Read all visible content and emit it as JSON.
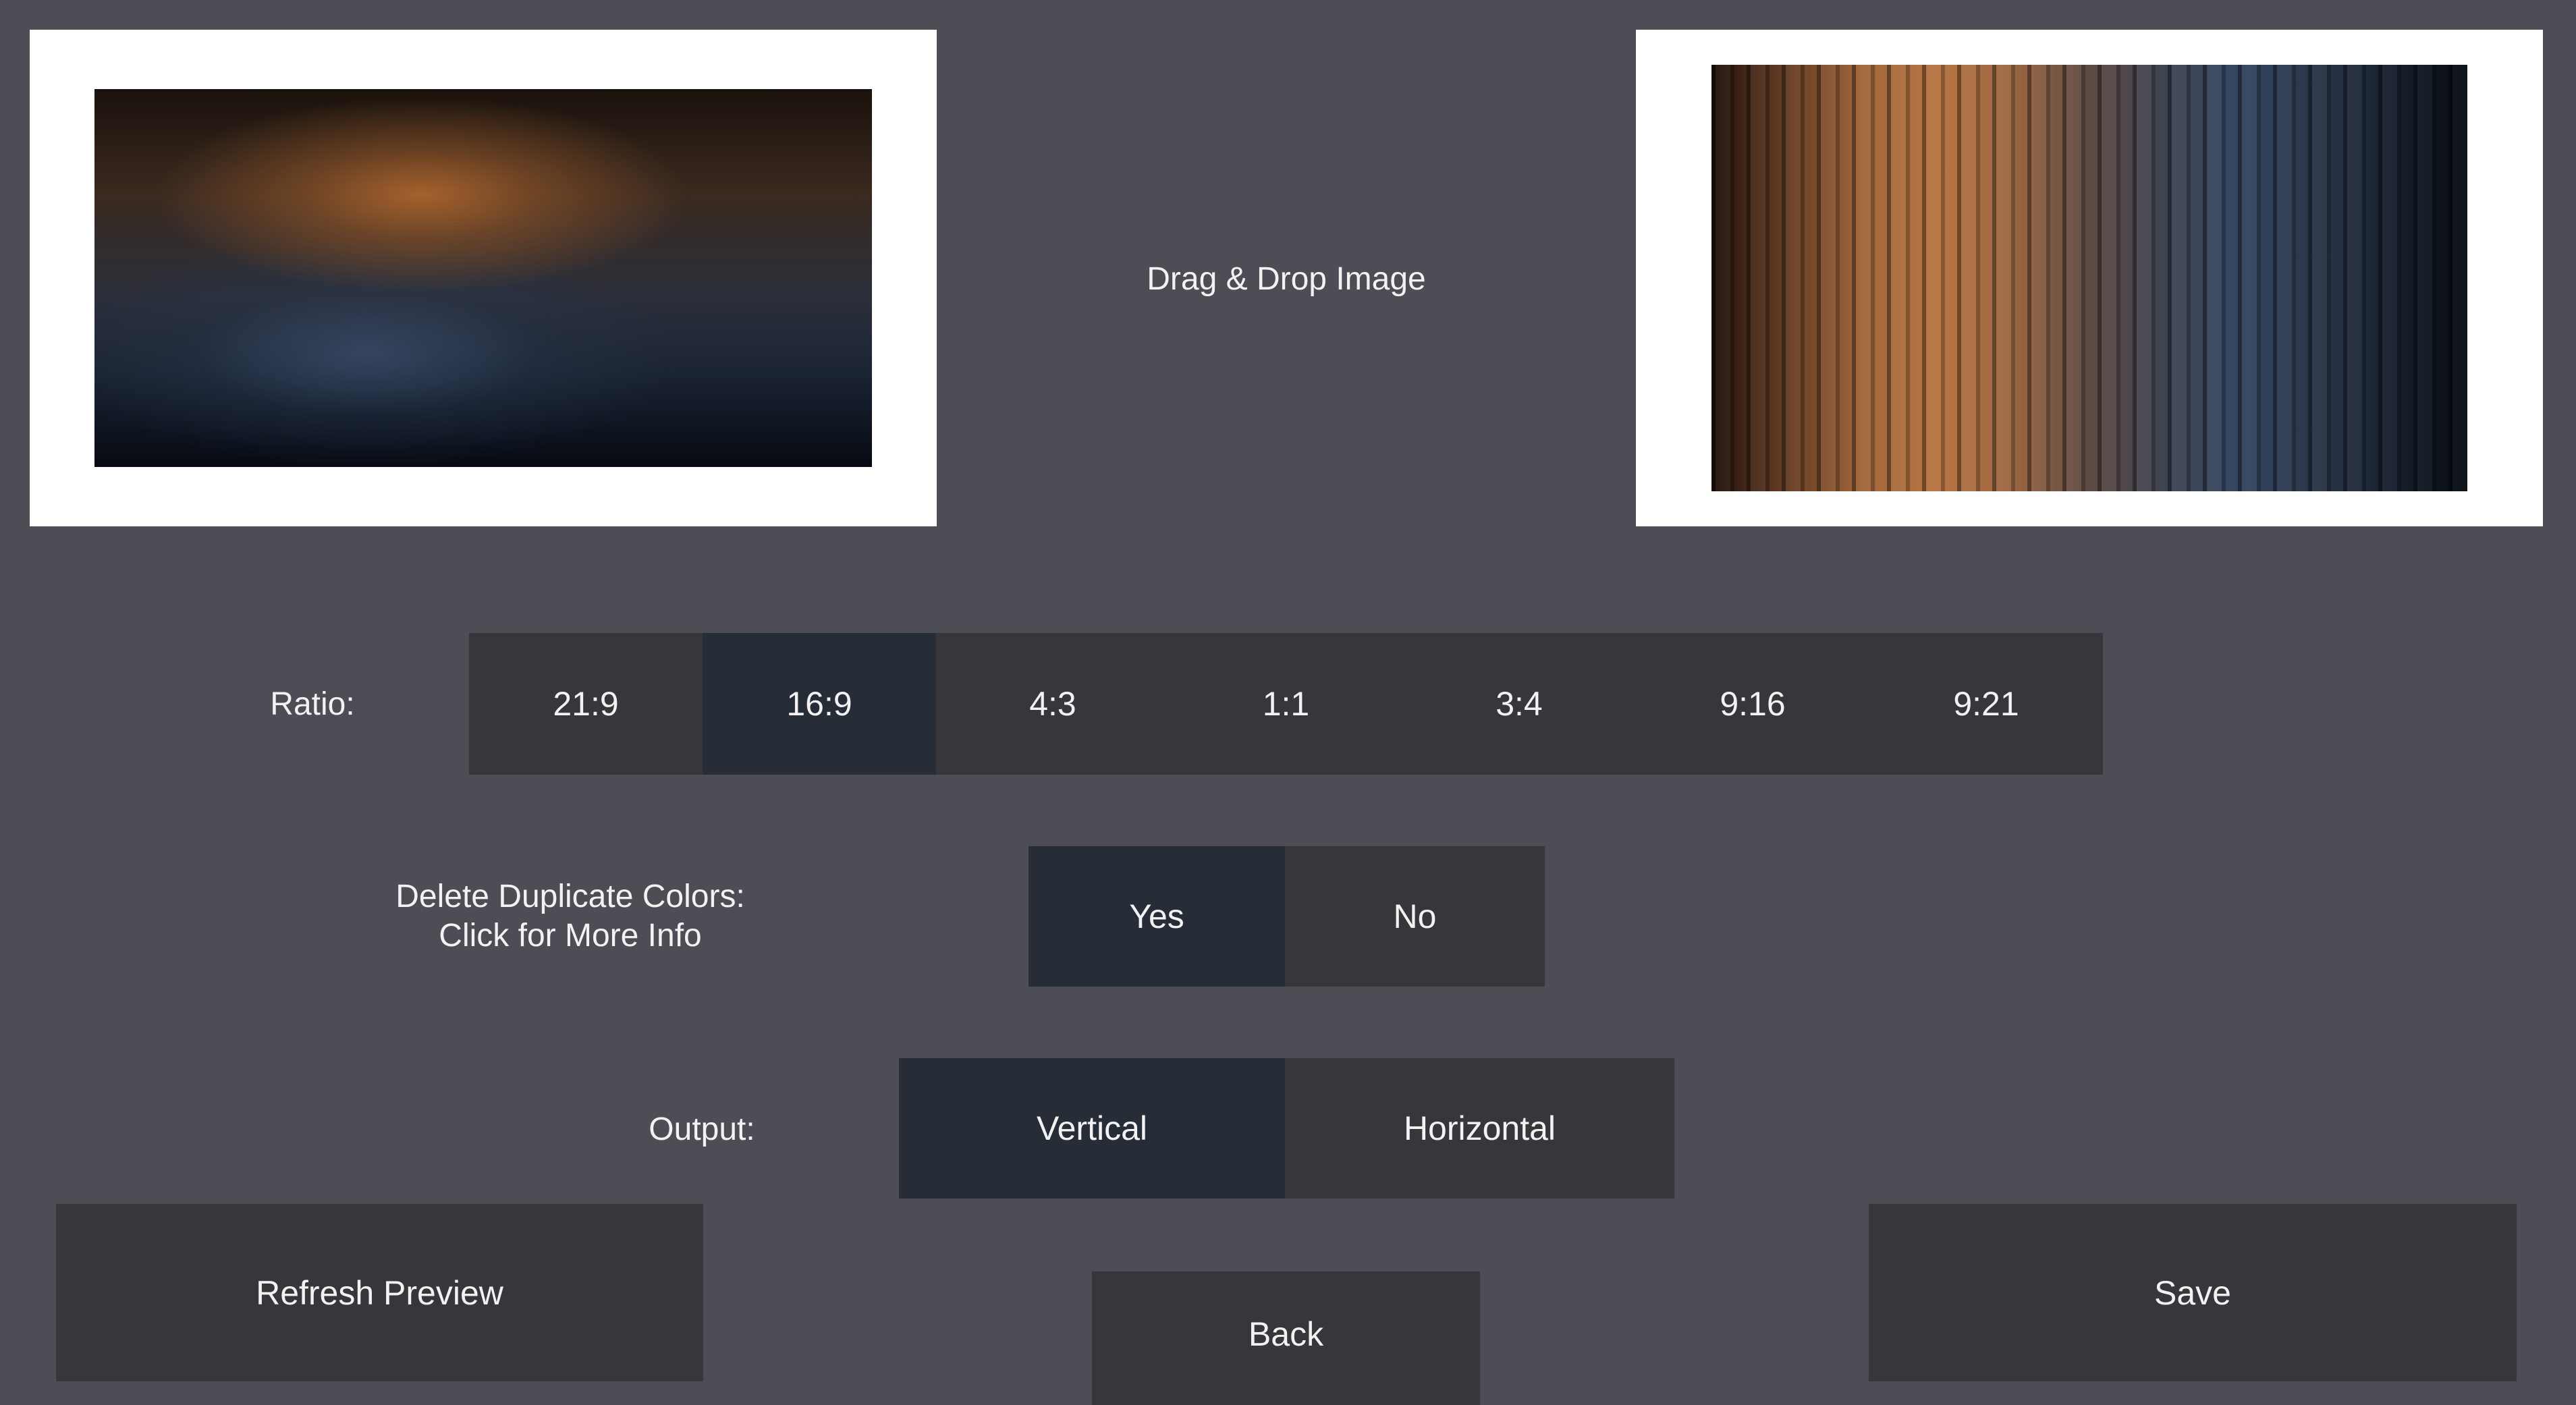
{
  "drop_zone": {
    "label": "Drag & Drop Image"
  },
  "ratio": {
    "label": "Ratio:",
    "options": [
      "21:9",
      "16:9",
      "4:3",
      "1:1",
      "3:4",
      "9:16",
      "9:21"
    ],
    "selected": "16:9"
  },
  "duplicates": {
    "label_line1": "Delete Duplicate Colors:",
    "label_line2": "Click for More Info",
    "yes": "Yes",
    "no": "No",
    "selected": "Yes"
  },
  "output": {
    "label": "Output:",
    "vertical": "Vertical",
    "horizontal": "Horizontal",
    "selected": "Vertical"
  },
  "buttons": {
    "refresh": "Refresh Preview",
    "back": "Back",
    "save": "Save"
  }
}
